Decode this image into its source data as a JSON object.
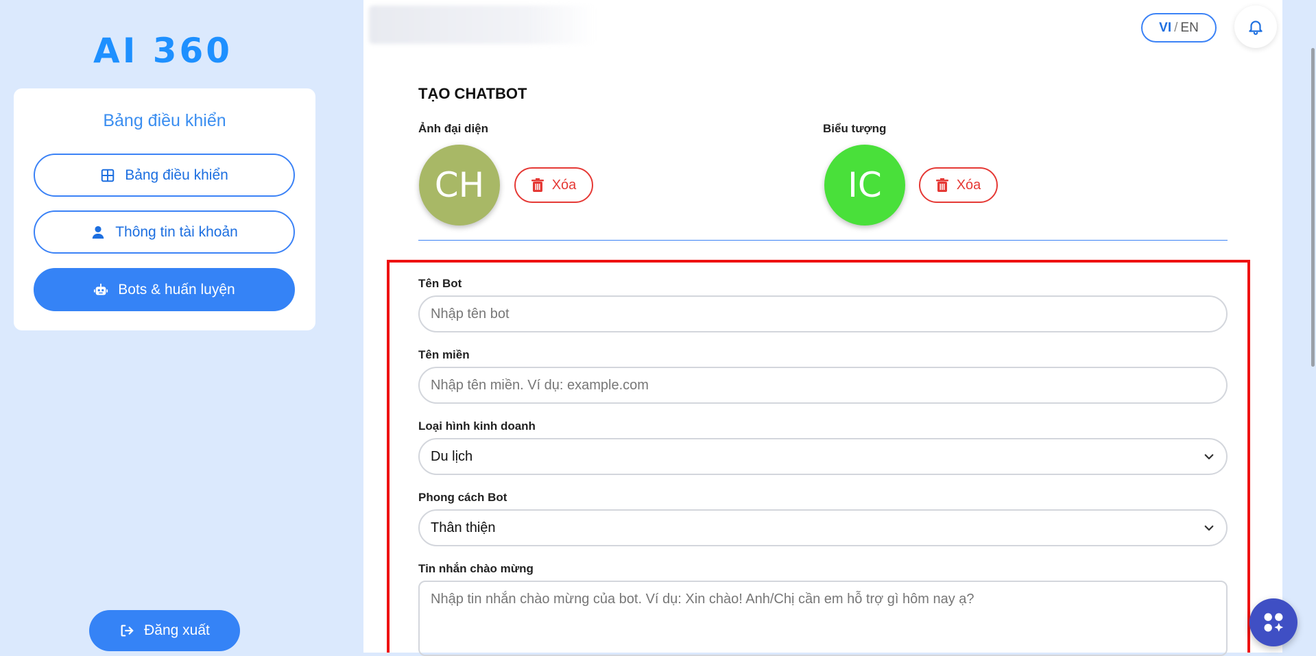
{
  "brand": {
    "logo_text": "AI 360"
  },
  "sidebar": {
    "title": "Bảng điều khiển",
    "items": [
      {
        "label": "Bảng điều khiển",
        "icon": "grid-icon",
        "active": false
      },
      {
        "label": "Thông tin tài khoản",
        "icon": "user-icon",
        "active": false
      },
      {
        "label": "Bots & huấn luyện",
        "icon": "robot-icon",
        "active": true
      }
    ],
    "logout_label": "Đăng xuất"
  },
  "header": {
    "lang": {
      "vi": "VI",
      "separator": "/",
      "en": "EN",
      "selected": "VI"
    }
  },
  "form": {
    "title": "TẠO CHATBOT",
    "avatar": {
      "label": "Ảnh đại diện",
      "initials": "CH",
      "color": "#a8b866",
      "delete_label": "Xóa"
    },
    "icon": {
      "label": "Biểu tượng",
      "initials": "IC",
      "color": "#49e03a",
      "delete_label": "Xóa"
    },
    "bot_name": {
      "label": "Tên Bot",
      "placeholder": "Nhập tên bot",
      "value": ""
    },
    "domain": {
      "label": "Tên miền",
      "placeholder": "Nhập tên miền. Ví dụ: example.com",
      "value": ""
    },
    "business_type": {
      "label": "Loại hình kinh doanh",
      "value": "Du lịch"
    },
    "bot_style": {
      "label": "Phong cách Bot",
      "value": "Thân thiện"
    },
    "welcome_message": {
      "label": "Tin nhắn chào mừng",
      "placeholder": "Nhập tin nhắn chào mừng của bot. Ví dụ: Xin chào! Anh/Chị cần em hỗ trợ gì hôm nay ạ?",
      "value": ""
    }
  },
  "colors": {
    "accent": "#3583f6",
    "danger": "#e53935",
    "highlight_frame": "#ee1111"
  }
}
